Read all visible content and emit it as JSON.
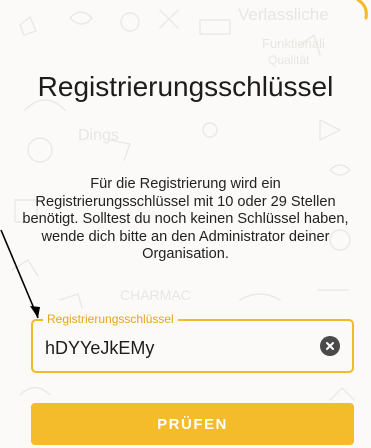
{
  "title": "Registrierungsschlüssel",
  "description": "Für die Registrierung wird ein Registrierungsschlüssel mit 10 oder 29 Stellen benötigt. Solltest du noch keinen Schlüssel haben, wende dich bitte an den Administrator deiner Organisation.",
  "field": {
    "label": "Registrierungsschlüssel",
    "value": "hDYYeJkEMy"
  },
  "button": {
    "label": "PRÜFEN"
  },
  "icons": {
    "clear": "clear-icon",
    "arrow": "arrow-annotation"
  },
  "colors": {
    "accent": "#f2b928",
    "button": "#f4bb2a",
    "label": "#e4a51a",
    "background": "#fbfaf9"
  }
}
